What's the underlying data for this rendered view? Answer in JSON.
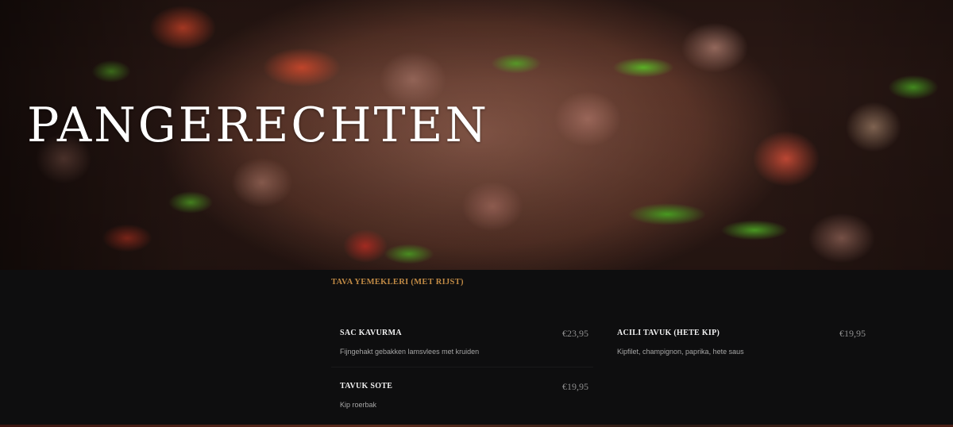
{
  "hero": {
    "title": "PANGERECHTEN",
    "image": "stir-fried-lamb-with-peppers-and-tomatoes"
  },
  "menu": {
    "category": "TAVA YEMEKLERI (MET RIJST)",
    "items": [
      {
        "name": "SAC KAVURMA",
        "price": "€23,95",
        "description": "Fijngehakt gebakken lamsvlees met kruiden"
      },
      {
        "name": "ACILI TAVUK (HETE KIP)",
        "price": "€19,95",
        "description": "Kipfilet, champignon, paprika, hete saus"
      },
      {
        "name": "TAVUK SOTE",
        "price": "€19,95",
        "description": "Kip roerbak"
      }
    ]
  },
  "colors": {
    "accent": "#c08a45",
    "background": "#0e0e0f",
    "item_name": "#f1f1f1",
    "price": "#8e8e8e",
    "description": "#a6a6a6"
  }
}
